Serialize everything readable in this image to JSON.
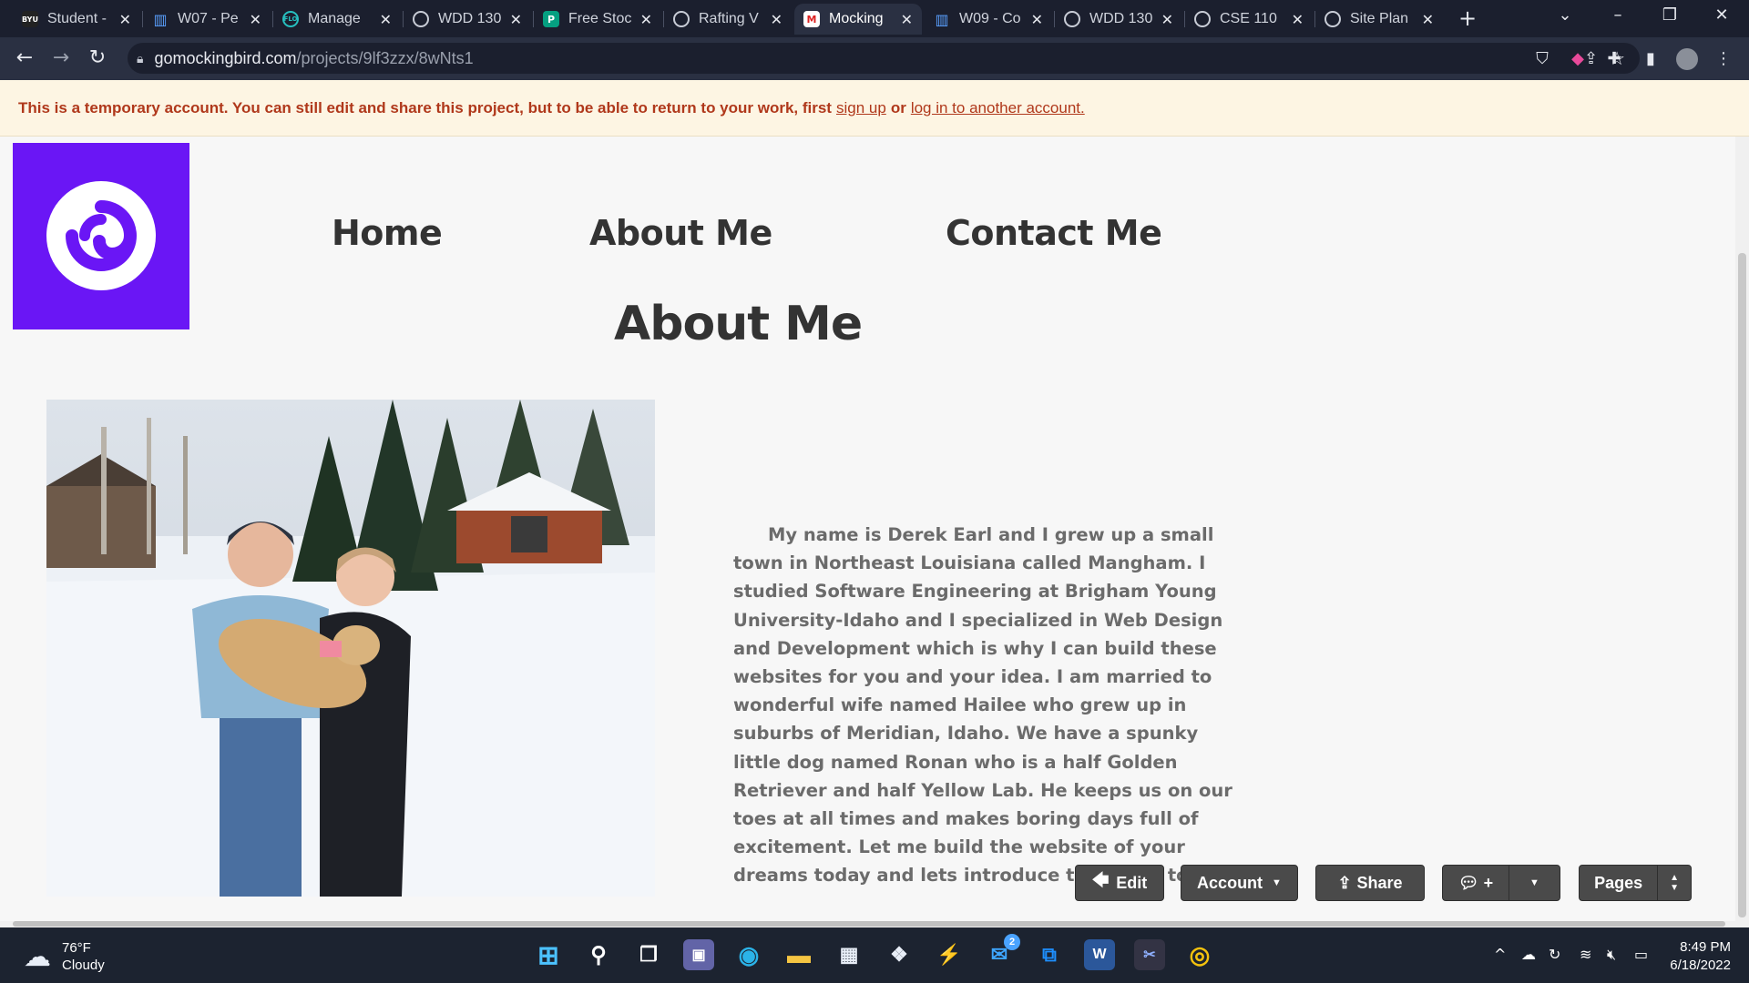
{
  "browser": {
    "tabs": [
      {
        "title": "Student -",
        "icon": "byu-icon",
        "active": false
      },
      {
        "title": "W07 - Pe",
        "icon": "chart-icon",
        "active": false
      },
      {
        "title": "Manage",
        "icon": "flo-icon",
        "active": false
      },
      {
        "title": "WDD 130",
        "icon": "globe-icon",
        "active": false
      },
      {
        "title": "Free Stoc",
        "icon": "pexels-icon",
        "active": false
      },
      {
        "title": "Rafting V",
        "icon": "globe-icon",
        "active": false
      },
      {
        "title": "Mocking",
        "icon": "mockingbird-icon",
        "active": true
      },
      {
        "title": "W09 - Co",
        "icon": "chart-icon",
        "active": false
      },
      {
        "title": "WDD 130",
        "icon": "globe-icon",
        "active": false
      },
      {
        "title": "CSE 110",
        "icon": "globe-icon",
        "active": false
      },
      {
        "title": "Site Plan",
        "icon": "globe-icon",
        "active": false
      }
    ],
    "url_host": "gomockingbird.com",
    "url_path": "/projects/9lf3zzx/8wNts1"
  },
  "banner": {
    "text": "This is a temporary account. You can still edit and share this project, but to be able to return to your work, first",
    "signup": "sign up",
    "or": "or",
    "login": "log in to another account."
  },
  "nav": {
    "home": "Home",
    "about": "About Me",
    "contact": "Contact Me"
  },
  "heading": "About Me",
  "bio": "My name is Derek Earl and I grew up a small town in Northeast Louisiana called Mangham. I studied Software Engineering at Brigham Young University-Idaho and I specialized in Web Design and Development which is why I can build these websites for you and your idea.  I am married to wonderful wife named Hailee who grew up in suburbs of Meridian, Idaho.  We have a spunky little dog named Ronan who is a half Golden Retriever and half Yellow Lab.  He keeps us on our toes at all times and makes boring days full of excitement.  Let me build the website of your dreams today and lets introduce the world to you.",
  "toolbar": {
    "edit": "Edit",
    "account": "Account",
    "share": "Share",
    "comment": "+",
    "pages": "Pages"
  },
  "taskbar": {
    "temp": "76°F",
    "condition": "Cloudy",
    "time": "8:49 PM",
    "date": "6/18/2022",
    "mail_badge": "2"
  },
  "colors": {
    "logo_bg": "#6a16f5",
    "banner_bg": "#fdf5e3",
    "banner_text": "#b0381b",
    "toolbar_btn": "#4a4a4a"
  }
}
